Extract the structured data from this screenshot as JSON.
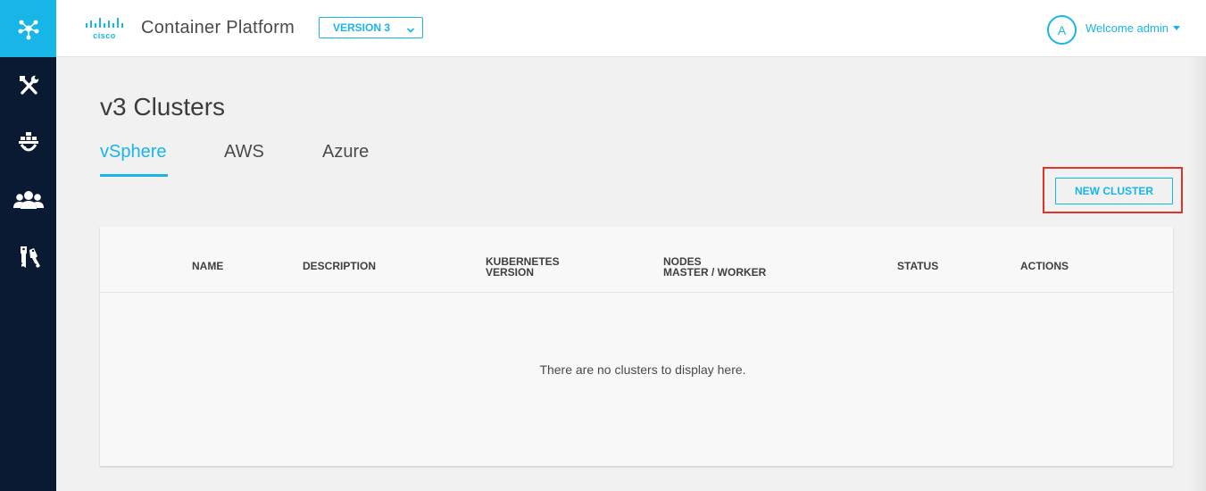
{
  "header": {
    "app_title": "Container Platform",
    "logo_text": "cisco",
    "version_select": {
      "selected": "VERSION 3"
    },
    "user": {
      "avatar_initial": "A",
      "welcome_text": "Welcome admin"
    }
  },
  "sidebar": {
    "items": [
      {
        "icon": "network-icon",
        "active": true
      },
      {
        "icon": "tools-icon"
      },
      {
        "icon": "docker-icon"
      },
      {
        "icon": "users-icon"
      },
      {
        "icon": "keys-icon"
      }
    ]
  },
  "main": {
    "page_title": "v3 Clusters",
    "tabs": [
      {
        "label": "vSphere",
        "active": true
      },
      {
        "label": "AWS"
      },
      {
        "label": "Azure"
      }
    ],
    "new_cluster_label": "NEW CLUSTER",
    "table": {
      "columns": [
        {
          "lines": [
            "NAME"
          ]
        },
        {
          "lines": [
            "DESCRIPTION"
          ]
        },
        {
          "lines": [
            "KUBERNETES",
            "VERSION"
          ]
        },
        {
          "lines": [
            "NODES",
            "MASTER / WORKER"
          ]
        },
        {
          "lines": [
            "STATUS"
          ]
        },
        {
          "lines": [
            "ACTIONS"
          ]
        }
      ],
      "empty_message": "There are no clusters to display here."
    }
  },
  "colors": {
    "accent": "#18b5e8",
    "sidebar_bg": "#0a1a33",
    "highlight": "#e4322b",
    "page_bg": "#f1f1f1"
  }
}
